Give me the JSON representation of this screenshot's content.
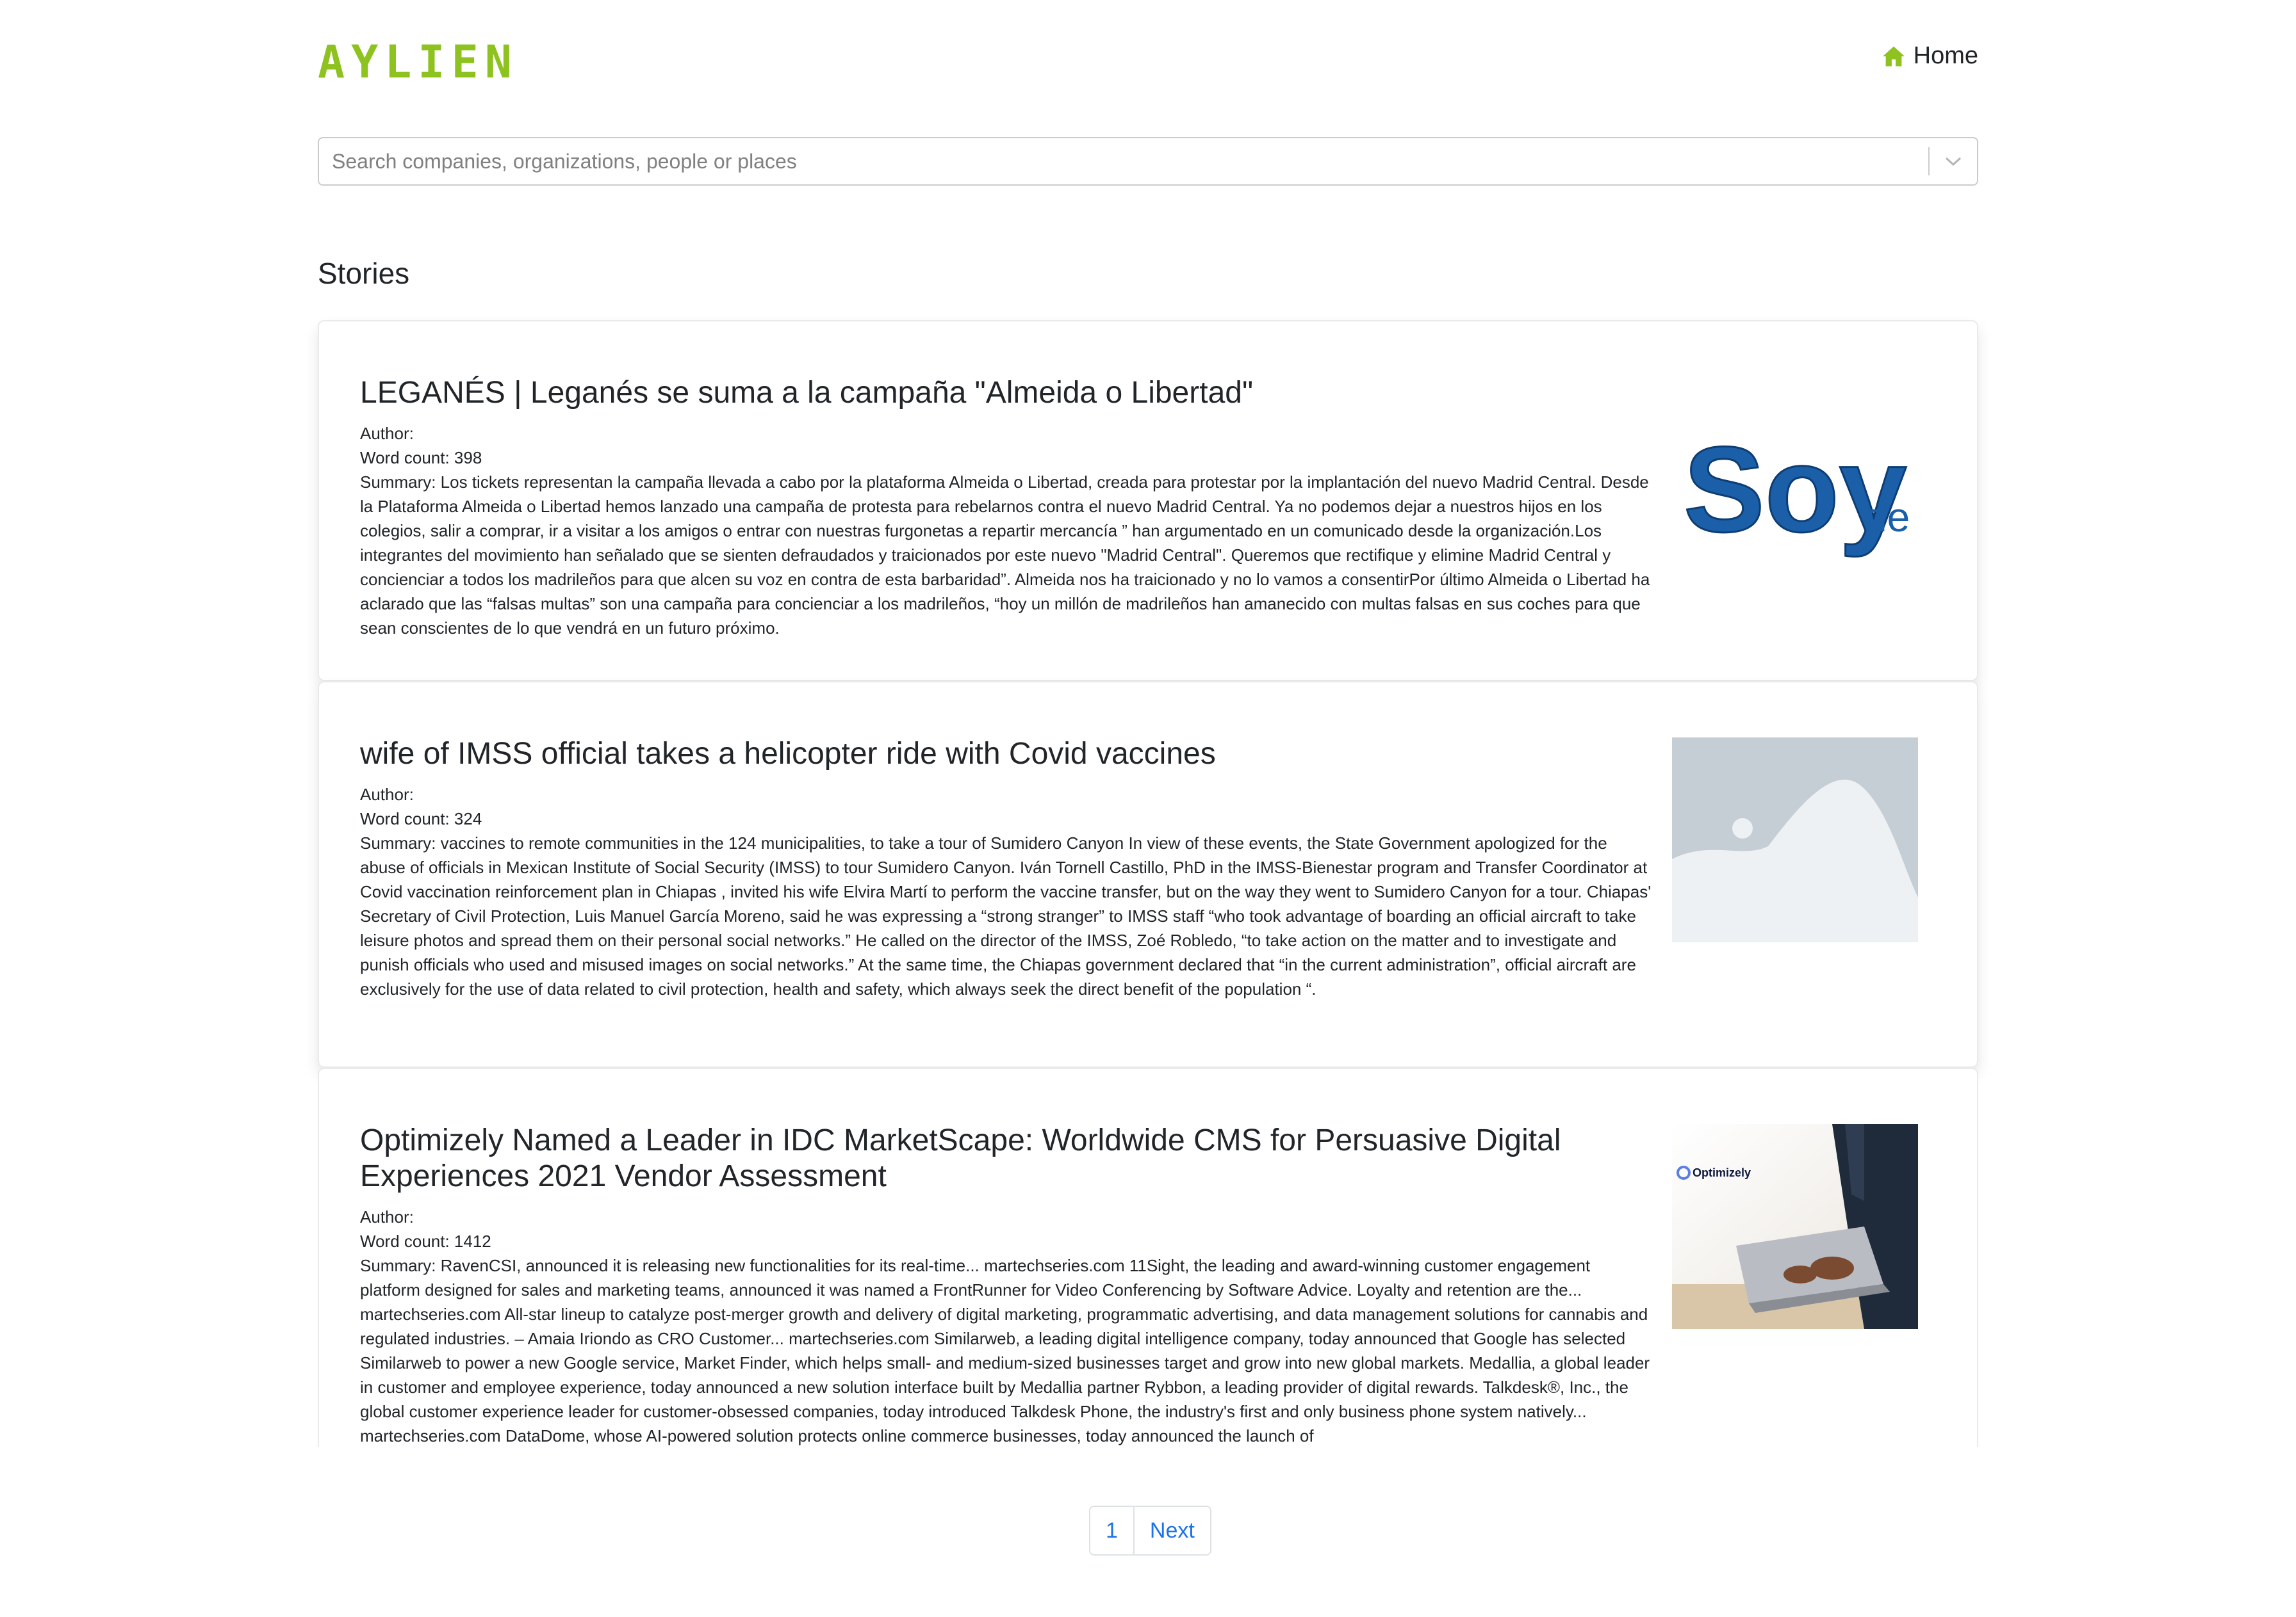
{
  "header": {
    "logo_text": "AYLIEN",
    "home_label": "Home",
    "accent_color": "#8dc21f"
  },
  "search": {
    "placeholder": "Search companies, organizations, people or places",
    "value": ""
  },
  "section_title": "Stories",
  "stories": [
    {
      "title": "LEGANÉS | Leganés se suma a la campaña \"Almeida o Libertad\"",
      "author": "Author:",
      "word_count": "Word count: 398",
      "summary": "Summary: Los tickets representan la campaña llevada a cabo por la plataforma Almeida o Libertad, creada para protestar por la implantación del nuevo Madrid Central. Desde la Plataforma Almeida o Libertad hemos lanzado una campaña de protesta para rebelarnos contra el nuevo Madrid Central. Ya no podemos dejar a nuestros hijos en los colegios, salir a comprar, ir a visitar a los amigos o entrar con nuestras furgonetas a repartir mercancía ” han argumentado en un comunicado desde la organización.Los integrantes del movimiento han señalado que se sienten defraudados y traicionados por este nuevo \"Madrid Central\". Queremos que rectifique y elimine Madrid Central y concienciar a todos los madrileños para que alcen su voz en contra de esta barbaridad”. Almeida nos ha traicionado y no lo vamos a consentirPor último Almeida o Libertad ha aclarado que las “falsas multas” son una campaña para concienciar a los madrileños, “hoy un millón de madrileños han amanecido con multas falsas en sus coches para que sean conscientes de lo que vendrá en un futuro próximo.",
      "image": {
        "type": "logo",
        "text_main": "Soy",
        "text_small": "de"
      }
    },
    {
      "title": "wife of IMSS official takes a helicopter ride with Covid vaccines",
      "author": "Author:",
      "word_count": "Word count: 324",
      "summary": "Summary: vaccines to remote communities in the 124 municipalities, to take a tour of Sumidero Canyon In view of these events, the State Government apologized for the abuse of officials in Mexican Institute of Social Security (IMSS) to tour Sumidero Canyon. Iván Tornell Castillo, PhD in the IMSS-Bienestar program and Transfer Coordinator at Covid vaccination reinforcement plan in Chiapas , invited his wife Elvira Martí to perform the vaccine transfer, but on the way they went to Sumidero Canyon for a tour. Chiapas' Secretary of Civil Protection, Luis Manuel García Moreno, said he was expressing a “strong stranger” to IMSS staff “who took advantage of boarding an official aircraft to take leisure photos and spread them on their personal social networks.” He called on the director of the IMSS, Zoé Robledo, “to take action on the matter and to investigate and punish officials who used and misused images on social networks.” At the same time, the Chiapas government declared that “in the current administration”, official aircraft are exclusively for the use of data related to civil protection, health and safety, which always seek the direct benefit of the population “.",
      "image": {
        "type": "placeholder"
      }
    },
    {
      "title": "Optimizely Named a Leader in IDC MarketScape: Worldwide CMS for Persuasive Digital Experiences 2021 Vendor Assessment",
      "author": "Author:",
      "word_count": "Word count: 1412",
      "summary": "Summary: RavenCSI, announced it is releasing new functionalities for its real-time... martechseries.com 11Sight, the leading and award-winning customer engagement platform designed for sales and marketing teams, announced it was named a FrontRunner for Video Conferencing by Software Advice. Loyalty and retention are the... martechseries.com All-star lineup to catalyze post-merger growth and delivery of digital marketing, programmatic advertising, and data management solutions for cannabis and regulated industries. – Amaia Iriondo as CRO Customer... martechseries.com Similarweb, a leading digital intelligence company, today announced that Google has selected Similarweb to power a new Google service, Market Finder, which helps small- and medium-sized businesses target and grow into new global markets. Medallia, a global leader in customer and employee experience, today announced a new solution interface built by Medallia partner Rybbon, a leading provider of digital rewards. Talkdesk®, Inc., the global customer experience leader for customer-obsessed companies, today introduced Talkdesk Phone, the industry's first and only business phone system natively... martechseries.com DataDome, whose AI-powered solution protects online commerce businesses, today announced the launch of",
      "image": {
        "type": "photo",
        "brand": "Optimizely"
      }
    }
  ],
  "pagination": {
    "current": "1",
    "next_label": "Next"
  }
}
